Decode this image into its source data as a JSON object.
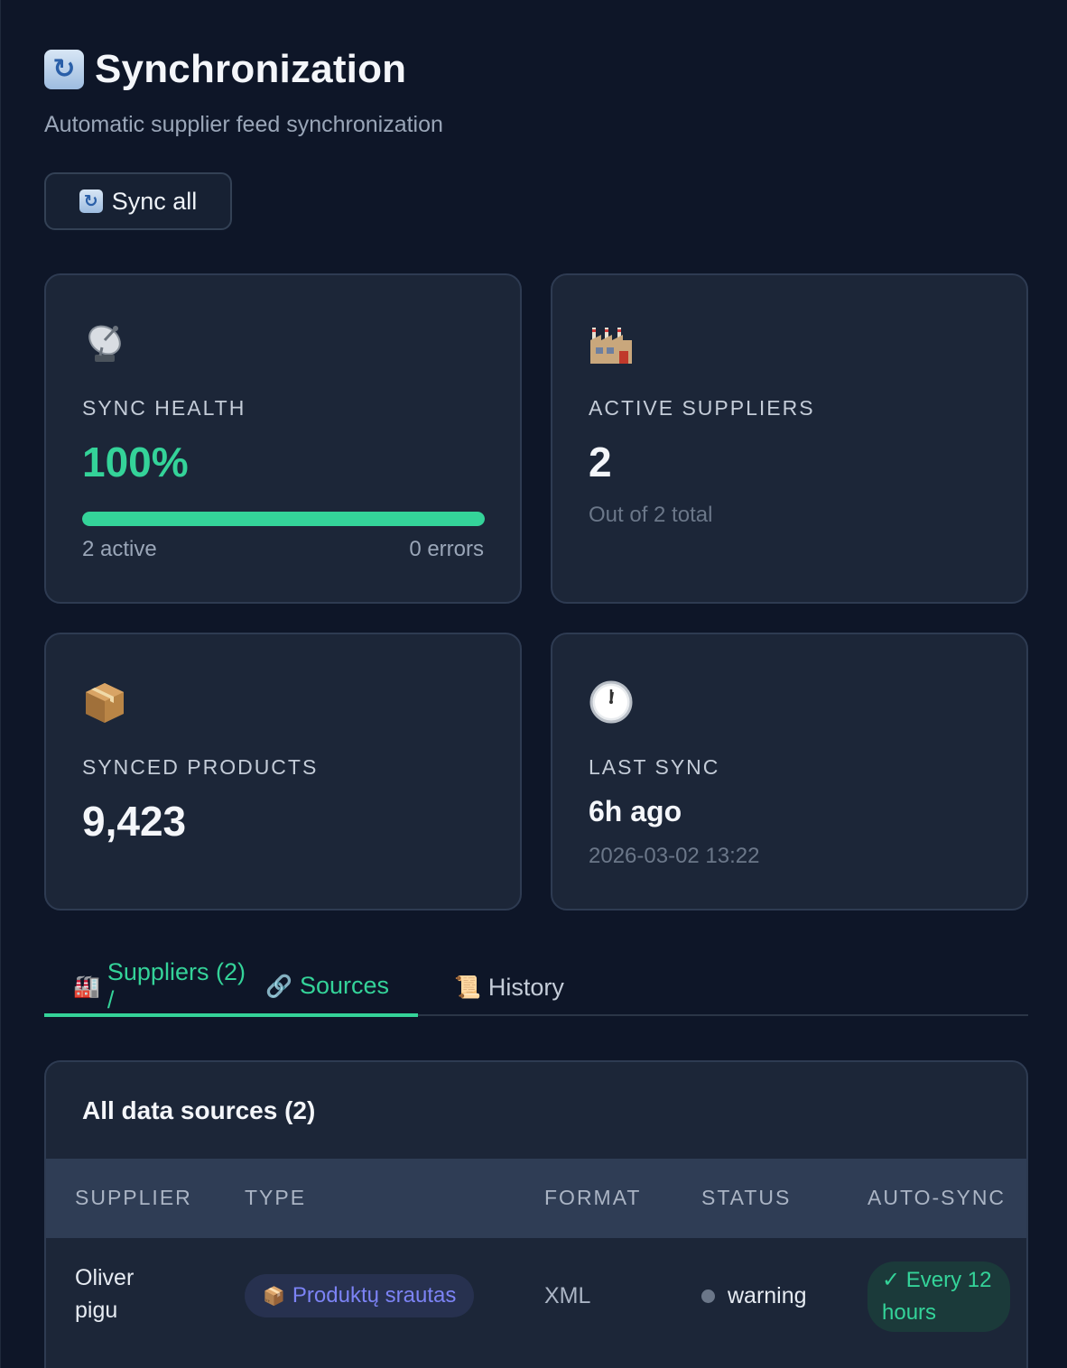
{
  "header": {
    "title": "Synchronization",
    "subtitle": "Automatic supplier feed synchronization",
    "sync_button": "Sync all"
  },
  "stats": {
    "sync_health": {
      "label": "Sync health",
      "value": "100%",
      "progress": 1.0,
      "active": "2 active",
      "errors": "0 errors",
      "icon": "satellite-dish-icon"
    },
    "active_suppliers": {
      "label": "Active suppliers",
      "value": "2",
      "note": "Out of 2 total",
      "icon": "factory-icon"
    },
    "synced_products": {
      "label": "Synced products",
      "value": "9,423",
      "icon": "package-icon"
    },
    "last_sync": {
      "label": "Last sync",
      "value": "6h ago",
      "note": "2026-03-02 13:22",
      "icon": "clock-icon"
    }
  },
  "tabs": {
    "suppliers": "Suppliers (2) / ",
    "sources": "Sources",
    "history": "History"
  },
  "table": {
    "title": "All data sources (2)",
    "columns": [
      "SUPPLIER",
      "TYPE",
      "FORMAT",
      "STATUS",
      "AUTO-SYNC"
    ],
    "rows": [
      {
        "supplier_line1": "Oliver",
        "supplier_line2": "pigu",
        "type": "Produktų srautas",
        "format": "XML",
        "status": "warning",
        "autosync_line1": "Every 12",
        "autosync_line2": "hours"
      }
    ]
  },
  "colors": {
    "accent": "#34d399",
    "background": "#0e1628",
    "card": "#1c2638",
    "type_pill_text": "#7c83f5"
  }
}
